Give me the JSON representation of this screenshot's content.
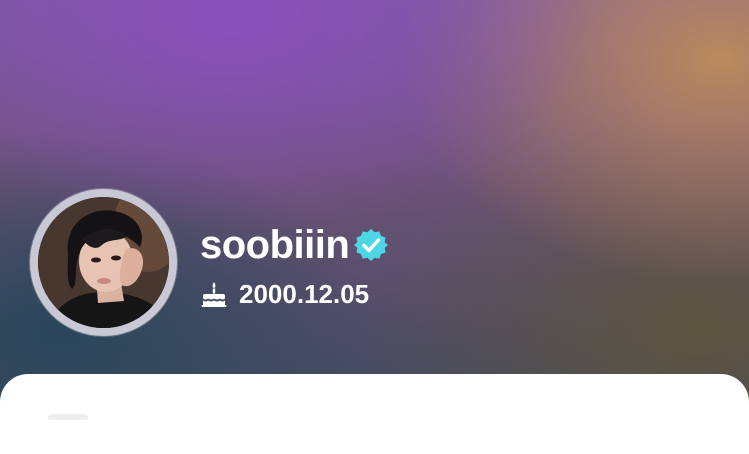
{
  "profile": {
    "username": "soobiiin",
    "verified": true,
    "birthday": "2000.12.05",
    "avatar_alt": "profile photo"
  },
  "icons": {
    "verified": "verified-badge-icon",
    "birthday": "cake-icon"
  },
  "colors": {
    "verified_badge": "#4fd6e6",
    "text": "#ffffff",
    "card": "#ffffff",
    "avatar_ring": "#c9c9d6"
  }
}
